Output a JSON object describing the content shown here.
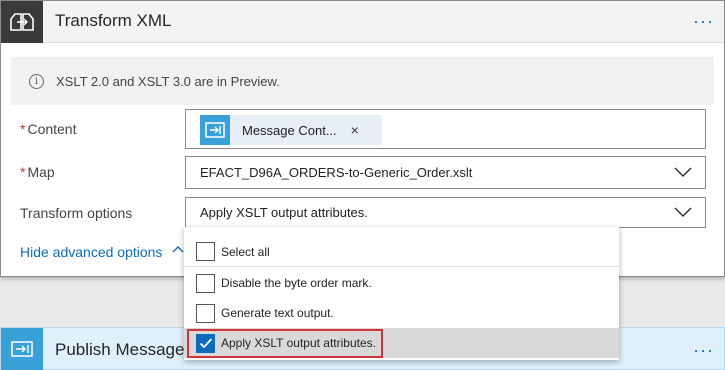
{
  "transform_card": {
    "title": "Transform XML",
    "menu_label": "···",
    "info_text": "XSLT 2.0 and XSLT 3.0 are in Preview.",
    "content_label": "Content",
    "content_token": "Message Cont...",
    "content_token_remove": "×",
    "map_label": "Map",
    "map_value": "EFACT_D96A_ORDERS-to-Generic_Order.xslt",
    "transform_options_label": "Transform options",
    "transform_options_value": "Apply XSLT output attributes.",
    "required_marker": "*",
    "advanced_link": "Hide advanced options"
  },
  "dropdown": {
    "options": [
      {
        "label": "Select all",
        "checked": false
      },
      {
        "label": "Disable the byte order mark.",
        "checked": false
      },
      {
        "label": "Generate text output.",
        "checked": false
      },
      {
        "label": "Apply XSLT output attributes.",
        "checked": true
      }
    ]
  },
  "publish_card": {
    "title": "Publish Message",
    "menu_label": "···"
  },
  "colors": {
    "accent": "#0f6cbd",
    "required": "#d13438",
    "token_icon": "#3aa0d8",
    "header_icon_bg": "#3a3a3a"
  }
}
